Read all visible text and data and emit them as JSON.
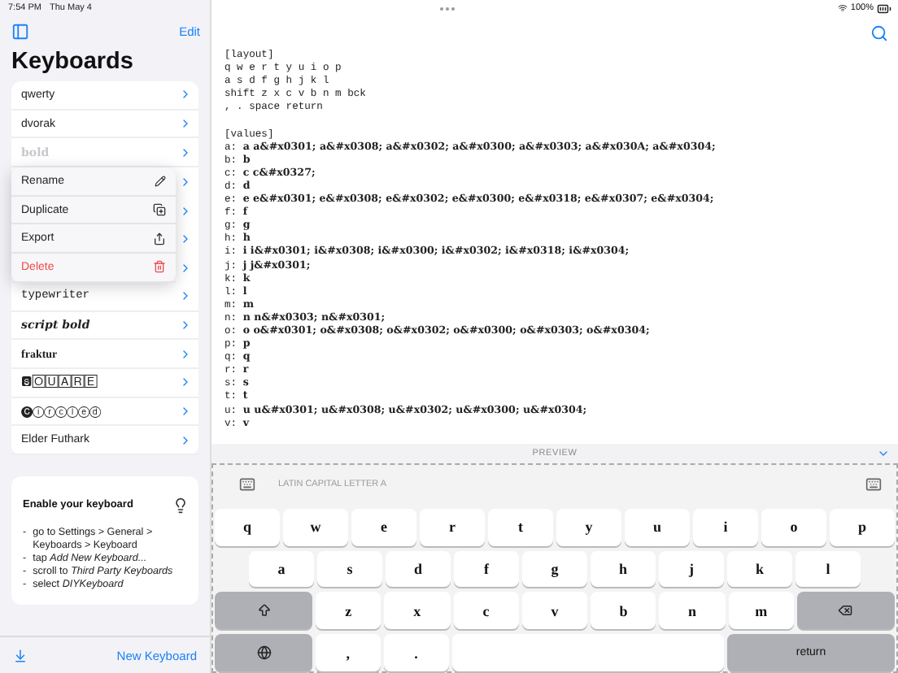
{
  "status_bar": {
    "time": "7:54 PM",
    "date": "Thu May 4",
    "battery": "100%"
  },
  "sidebar": {
    "edit": "Edit",
    "title": "Keyboards",
    "keyboards_above_menu": [
      {
        "name": "qwerty",
        "kind": "plain",
        "dimmed": false
      },
      {
        "name": "dvorak",
        "kind": "plain",
        "dimmed": false
      },
      {
        "name": "bold",
        "kind": "bold",
        "dimmed": true
      }
    ],
    "context_menu": [
      {
        "label": "Rename",
        "kind": "rename"
      },
      {
        "label": "Duplicate",
        "kind": "duplicate"
      },
      {
        "label": "Export",
        "kind": "export"
      },
      {
        "label": "Delete",
        "kind": "delete"
      }
    ],
    "keyboards_below_menu": [
      {
        "name": "typewriter",
        "kind": "mono",
        "dimmed": false
      },
      {
        "name": "script bold",
        "kind": "script",
        "dimmed": false
      },
      {
        "name": "fraktur",
        "kind": "fraktur",
        "dimmed": false
      },
      {
        "name": "🆂🄾🅄🄰🅁🄴",
        "kind": "plain",
        "dimmed": false
      },
      {
        "name": "🅒ⓘⓡⓒⓛⓔⓓ",
        "kind": "plain",
        "dimmed": false
      },
      {
        "name": "Elder Futhark",
        "kind": "plain",
        "dimmed": false
      }
    ],
    "tip": {
      "title": "Enable your keyboard",
      "steps": [
        {
          "bullet": "-",
          "text": "go to Settings > General > Keyboards > Keyboard"
        },
        {
          "bullet": "-",
          "text": "tap *Add New Keyboard...*"
        },
        {
          "bullet": "-",
          "text": "scroll to *Third Party Keyboards*"
        },
        {
          "bullet": "-",
          "text": "select *DIYKeyboard*"
        }
      ]
    },
    "new_button": "New Keyboard"
  },
  "editor": {
    "blocks": [
      {
        "lines": [
          "[layout]",
          "q w e r t y u i o p",
          "a s d f g h j k l",
          "shift z x c v b n m bck",
          ", . space return"
        ]
      },
      {
        "lines": [
          "[values]",
          "a: **a a&#x0301; a&#x0308; a&#x0302; a&#x0300; a&#x0303; a&#x030A; a&#x0304;**",
          "b: **b**",
          "c: **c c&#x0327;**",
          "d: **d**",
          "e: **e e&#x0301; e&#x0308; e&#x0302; e&#x0300; e&#x0318; e&#x0307; e&#x0304;**",
          "f: **f**",
          "g: **g**",
          "h: **h**",
          "i: **i i&#x0301; i&#x0308; i&#x0300; i&#x0302; i&#x0318; i&#x0304;**",
          "j: **j j&#x0301;**",
          "k: **k**",
          "l: **l**",
          "m: **m**",
          "n: **n n&#x0303; n&#x0301;**",
          "o: **o o&#x0301; o&#x0308; o&#x0302; o&#x0300; o&#x0303; o&#x0304;**",
          "p: **p**",
          "q: **q**",
          "r: **r**",
          "s: **s**",
          "t: **t**",
          "u: **u u&#x0301; u&#x0308; u&#x0302; u&#x0300; u&#x0304;**",
          "v: **v**"
        ]
      }
    ]
  },
  "preview": {
    "title": "PREVIEW",
    "character_name": "LATIN CAPITAL LETTER A",
    "rows": [
      [
        {
          "kind": "letter",
          "label": "q"
        },
        {
          "kind": "letter",
          "label": "w"
        },
        {
          "kind": "letter",
          "label": "e"
        },
        {
          "kind": "letter",
          "label": "r"
        },
        {
          "kind": "letter",
          "label": "t"
        },
        {
          "kind": "letter",
          "label": "y"
        },
        {
          "kind": "letter",
          "label": "u"
        },
        {
          "kind": "letter",
          "label": "i"
        },
        {
          "kind": "letter",
          "label": "o"
        },
        {
          "kind": "letter",
          "label": "p"
        }
      ],
      [
        {
          "kind": "letter",
          "label": "a"
        },
        {
          "kind": "letter",
          "label": "s"
        },
        {
          "kind": "letter",
          "label": "d"
        },
        {
          "kind": "letter",
          "label": "f"
        },
        {
          "kind": "letter",
          "label": "g"
        },
        {
          "kind": "letter",
          "label": "h"
        },
        {
          "kind": "letter",
          "label": "j"
        },
        {
          "kind": "letter",
          "label": "k"
        },
        {
          "kind": "letter",
          "label": "l"
        }
      ],
      [
        {
          "kind": "shift"
        },
        {
          "kind": "letter",
          "label": "z"
        },
        {
          "kind": "letter",
          "label": "x"
        },
        {
          "kind": "letter",
          "label": "c"
        },
        {
          "kind": "letter",
          "label": "v"
        },
        {
          "kind": "letter",
          "label": "b"
        },
        {
          "kind": "letter",
          "label": "n"
        },
        {
          "kind": "letter",
          "label": "m"
        },
        {
          "kind": "backspace"
        }
      ],
      [
        {
          "kind": "globe"
        },
        {
          "kind": "letter",
          "label": ","
        },
        {
          "kind": "letter",
          "label": "."
        },
        {
          "kind": "space"
        },
        {
          "kind": "return",
          "label": "return"
        }
      ]
    ]
  }
}
